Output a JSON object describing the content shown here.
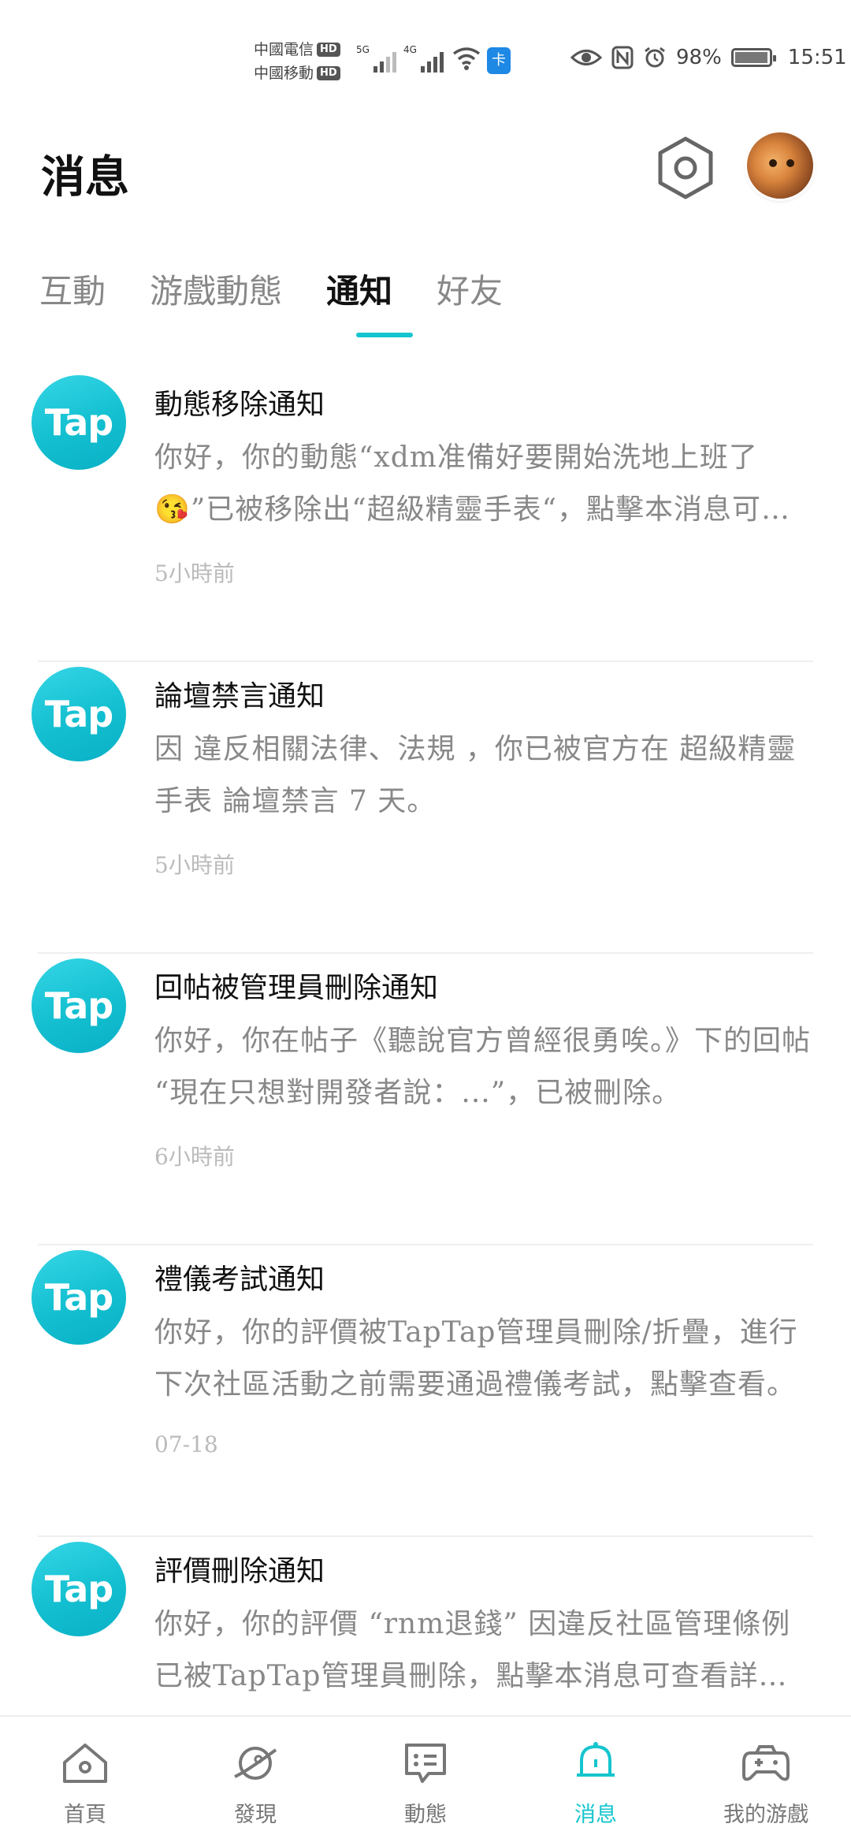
{
  "status_bar": {
    "carrier1": "中國電信",
    "carrier2": "中國移動",
    "hd": "HD",
    "net1": "5G",
    "net2": "4G",
    "battery_text": "98%",
    "battery_level": 0.98,
    "time": "15:51"
  },
  "header": {
    "title": "消息"
  },
  "tabs": [
    {
      "label": "互動",
      "active": false
    },
    {
      "label": "游戲動態",
      "active": false
    },
    {
      "label": "通知",
      "active": true
    },
    {
      "label": "好友",
      "active": false
    }
  ],
  "notifications": [
    {
      "avatar": "Tap",
      "title": "動態移除通知",
      "body": "你好，你的動態“xdm准備好要開始洗地上班了😘”已被移除出“超級精靈手表“，點擊本消息可查看詳情。",
      "time": "5小時前"
    },
    {
      "avatar": "Tap",
      "title": "論壇禁言通知",
      "body": "因 違反相關法律、法規 ，你已被官方在 超級精靈手表 論壇禁言 7 天。",
      "time": "5小時前"
    },
    {
      "avatar": "Tap",
      "title": "回帖被管理員刪除通知",
      "body": "你好，你在帖子《聽說官方曾經很勇唉。》下的回帖 “現在只想對開發者說：...”，已被刪除。",
      "time": "6小時前"
    },
    {
      "avatar": "Tap",
      "title": "禮儀考試通知",
      "body": "你好，你的評價被TapTap管理員刪除/折疊，進行下次社區活動之前需要通過禮儀考試，點擊查看。",
      "time": "07-18"
    },
    {
      "avatar": "Tap",
      "title": "評價刪除通知",
      "body": "你好，你的評價 “rnm退錢” 因違反社區管理條例已被TapTap管理員刪除，點擊本消息可查看詳情。",
      "time": ""
    }
  ],
  "bottom_nav": [
    {
      "label": "首頁",
      "icon": "home-icon",
      "active": false
    },
    {
      "label": "發現",
      "icon": "planet-icon",
      "active": false
    },
    {
      "label": "動態",
      "icon": "chat-icon",
      "active": false
    },
    {
      "label": "消息",
      "icon": "bell-icon",
      "active": true
    },
    {
      "label": "我的游戲",
      "icon": "gamepad-icon",
      "active": false
    }
  ],
  "colors": {
    "accent": "#15c5ce",
    "text_primary": "#111111",
    "text_secondary": "#888888",
    "time": "#bbbbbb"
  }
}
